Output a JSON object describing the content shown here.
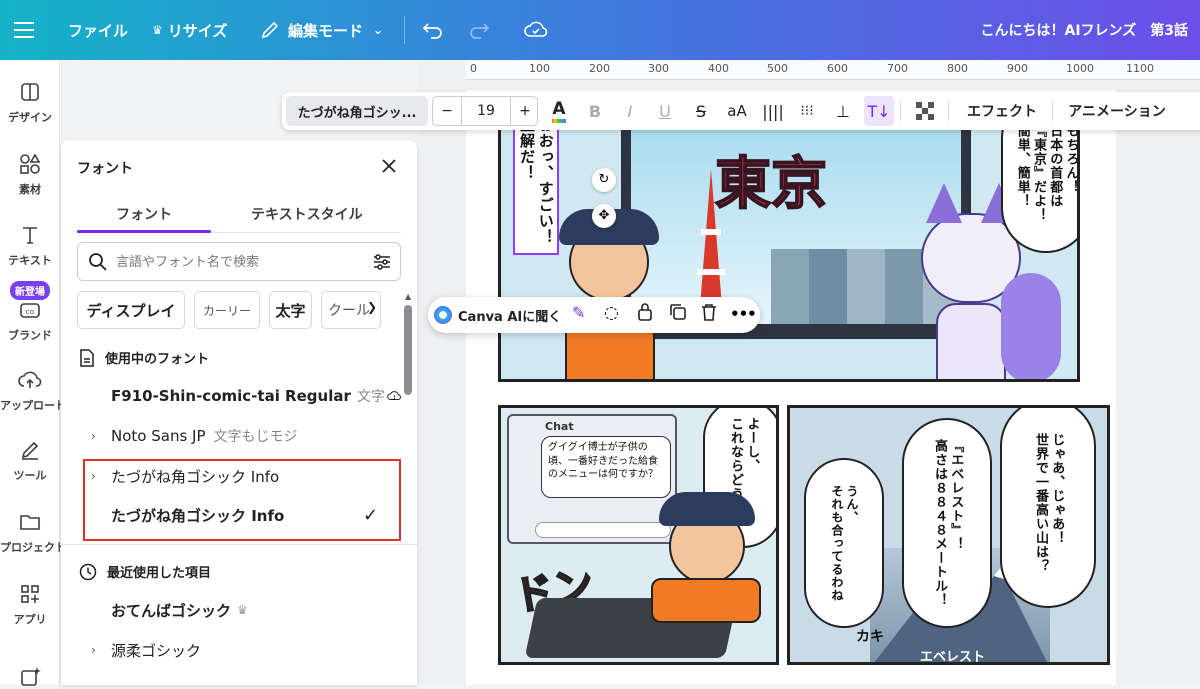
{
  "topbar": {
    "menu_icon": "hamburger-icon",
    "file": "ファイル",
    "resize": "リサイズ",
    "edit_mode": "編集モード",
    "title": "こんにちは！AIフレンズ　第3話"
  },
  "rail": [
    {
      "label": "デザイン",
      "icon": "layout-icon"
    },
    {
      "label": "素材",
      "icon": "shapes-icon"
    },
    {
      "label": "テキスト",
      "icon": "text-icon"
    },
    {
      "label": "ブランド",
      "icon": "brand-icon",
      "badge": "新登場"
    },
    {
      "label": "アップロード",
      "icon": "upload-icon"
    },
    {
      "label": "ツール",
      "icon": "pen-icon"
    },
    {
      "label": "プロジェクト",
      "icon": "folder-icon"
    },
    {
      "label": "アプリ",
      "icon": "apps-icon"
    }
  ],
  "font_panel": {
    "title": "フォント",
    "tabs": [
      "フォント",
      "テキストスタイル"
    ],
    "search_placeholder": "言語やフォント名で検索",
    "chips": [
      "ディスプレイ",
      "カーリー",
      "太字",
      "クール"
    ],
    "in_use_heading": "使用中のフォント",
    "in_use": [
      {
        "name": "F910-Shin-comic-tai Regular",
        "sample": "文字"
      },
      {
        "name": "Noto Sans JP",
        "sample": "文字もじモジ"
      },
      {
        "name": "たづがね角ゴシック Info"
      },
      {
        "name": "たづがね角ゴシック Info",
        "selected": true
      }
    ],
    "recent_heading": "最近使用した項目",
    "recent": [
      {
        "name": "おてんばゴシック"
      },
      {
        "name": "源柔ゴシック"
      }
    ]
  },
  "toolbar": {
    "font_name": "たづがね角ゴシッ...",
    "font_size": "19",
    "minus": "−",
    "plus": "+",
    "case": "aA",
    "effects": "エフェクト",
    "animation": "アニメーション"
  },
  "ruler": [
    "0",
    "100",
    "200",
    "300",
    "400",
    "500",
    "600",
    "700",
    "800",
    "900",
    "1000",
    "1100"
  ],
  "float_bar": {
    "ai_label": "Canva AIに聞く",
    "more": "•••"
  },
  "comic": {
    "panel1_bubble_left": "おおっ、すごい！正解だ！",
    "panel1_sign": "東京",
    "panel1_bubble_right": [
      "もちろん！",
      "日本の首都は",
      "『東京』だよ！",
      "簡単、簡単！"
    ],
    "panel2_chat_title": "Chat",
    "panel2_chat_text": "グイグイ博士が子供の頃、一番好きだった給食のメニューは何ですか？",
    "panel2_bubble": [
      "よーし、",
      "これならどうだ！"
    ],
    "panel2_sfx": "ドン",
    "panel3_bubble_a": [
      "じゃあ、じゃあ！",
      "世界で一番高い山は？"
    ],
    "panel3_bubble_b": [
      "『エベレスト』！",
      "高さは８８４８メートル！"
    ],
    "panel3_bubble_c": [
      "うん、",
      "それも合ってるわね"
    ],
    "panel3_label": "エベレスト",
    "panel3_sfx": "カキ"
  },
  "colors": {
    "accent": "#7d2ae8",
    "highlight_box": "#e0302a"
  }
}
